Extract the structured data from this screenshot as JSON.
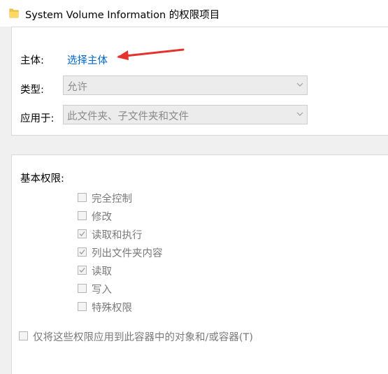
{
  "window": {
    "title": "System Volume Information 的权限项目",
    "icon": "folder-icon"
  },
  "principal": {
    "label": "主体:",
    "link": "选择主体"
  },
  "type": {
    "label": "类型:",
    "value": "允许"
  },
  "applies_to": {
    "label": "应用于:",
    "value": "此文件夹、子文件夹和文件"
  },
  "basic_permissions": {
    "title": "基本权限:",
    "items": [
      {
        "label": "完全控制",
        "checked": false
      },
      {
        "label": "修改",
        "checked": false
      },
      {
        "label": "读取和执行",
        "checked": true
      },
      {
        "label": "列出文件夹内容",
        "checked": true
      },
      {
        "label": "读取",
        "checked": true
      },
      {
        "label": "写入",
        "checked": false
      },
      {
        "label": "特殊权限",
        "checked": false
      }
    ]
  },
  "apply_only": {
    "label": "仅将这些权限应用到此容器中的对象和/或容器(T)",
    "checked": false
  },
  "colors": {
    "link": "#0066cc",
    "annotation_arrow": "#e5322d",
    "disabled_text": "#7a7a7a"
  }
}
